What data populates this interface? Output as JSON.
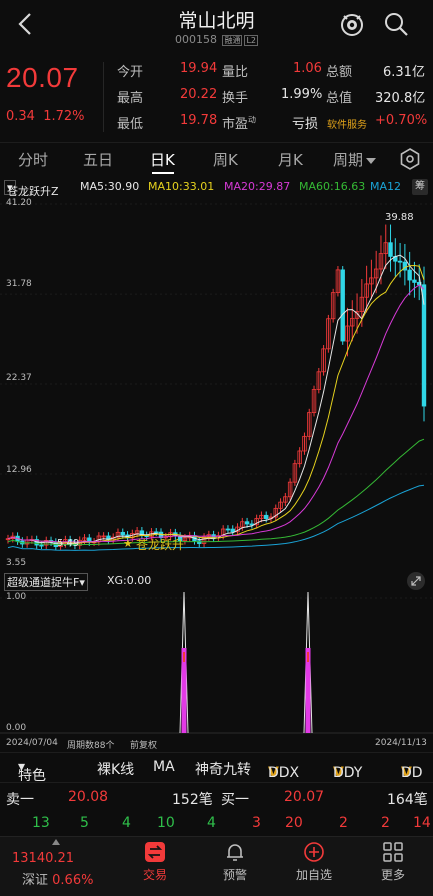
{
  "header": {
    "title": "常山北明",
    "code": "000158",
    "tags": "融通",
    "level": "L2"
  },
  "quote": {
    "price": "20.07",
    "change": "0.34",
    "change_pct": "1.72%",
    "open_label": "今开",
    "open": "19.94",
    "high_label": "最高",
    "high": "20.22",
    "low_label": "最低",
    "low": "19.78",
    "vol_ratio_label": "量比",
    "vol_ratio": "1.06",
    "turnover_label": "换手",
    "turnover": "1.99%",
    "pe_label": "市盈",
    "pe_sup": "动",
    "amount_label": "总额",
    "amount": "6.31亿",
    "mktcap_label": "总值",
    "mktcap": "320.8亿",
    "loss_label": "亏损",
    "service_label": "软件服务",
    "service_pct": "+0.70%"
  },
  "tabs": [
    "分时",
    "五日",
    "日K",
    "周K",
    "月K",
    "周期"
  ],
  "active_tab": "日K",
  "ma_bar": {
    "indicator": "苍龙跃升Z",
    "ma5": "MA5:30.90",
    "ma10": "MA10:33.01",
    "ma20": "MA20:29.87",
    "ma60": "MA60:16.63",
    "ma120": "MA12",
    "button": "筹"
  },
  "main_chart": {
    "y_labels": [
      "41.20",
      "31.78",
      "22.37",
      "12.96",
      "3.55"
    ],
    "high_mark": "39.88",
    "low_mark": "5.49",
    "signal": "苍龙跃升",
    "star": "★"
  },
  "sub_indicator": {
    "name": "超级通道捉牛F",
    "value": "XG:0.00",
    "y_top": "1.00",
    "y_bottom": "0.00"
  },
  "time_axis": {
    "start": "2024/07/04",
    "period": "周期数88个",
    "adjust": "前复权",
    "end": "2024/11/13"
  },
  "tools": [
    "特色",
    "裸K线",
    "MA",
    "神奇九转",
    "DDX",
    "DDY",
    "DD"
  ],
  "order_book": {
    "sell_label": "卖一",
    "sell_price": "20.08",
    "sell_qty": "152笔",
    "buy_label": "买一",
    "buy_price": "20.07",
    "buy_qty": "164笔",
    "ticks": [
      "13",
      "5",
      "4",
      "10",
      "4",
      "3",
      "20",
      "2",
      "2",
      "14"
    ]
  },
  "nav": {
    "index_value": "13140.21",
    "index_name": "深证",
    "index_pct": "0.66%",
    "items": [
      "交易",
      "预警",
      "加自选",
      "更多"
    ]
  },
  "colors": {
    "up": "#f23a3a",
    "down": "#2fbf4a",
    "ma5": "#e6e6e6",
    "ma10": "#e6d21e",
    "ma20": "#d63ad6",
    "ma60": "#35b935",
    "ma120": "#1aa3d6",
    "accent": "#e0a21a"
  }
}
